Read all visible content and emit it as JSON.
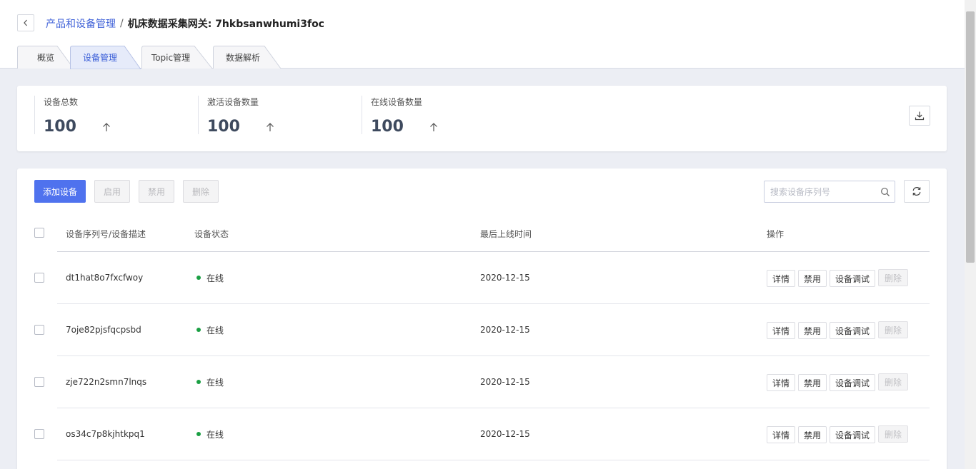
{
  "breadcrumb": {
    "parent": "产品和设备管理",
    "separator": "/",
    "current": "机床数据采集网关: 7hkbsanwhumi3foc"
  },
  "tabs": [
    {
      "label": "概览",
      "active": false
    },
    {
      "label": "设备管理",
      "active": true
    },
    {
      "label": "Topic管理",
      "active": false
    },
    {
      "label": "数据解析",
      "active": false
    }
  ],
  "stats": [
    {
      "label": "设备总数",
      "value": "100"
    },
    {
      "label": "激活设备数量",
      "value": "100"
    },
    {
      "label": "在线设备数量",
      "value": "100"
    }
  ],
  "toolbar": {
    "add_label": "添加设备",
    "enable_label": "启用",
    "disable_label": "禁用",
    "delete_label": "删除"
  },
  "search": {
    "placeholder": "搜索设备序列号"
  },
  "table": {
    "columns": [
      "设备序列号/设备描述",
      "设备状态",
      "最后上线时间",
      "操作"
    ],
    "rows": [
      {
        "serial": "dt1hat8o7fxcfwoy",
        "status": "在线",
        "last_online": "2020-12-15"
      },
      {
        "serial": "7oje82pjsfqcpsbd",
        "status": "在线",
        "last_online": "2020-12-15"
      },
      {
        "serial": "zje722n2smn7lnqs",
        "status": "在线",
        "last_online": "2020-12-15"
      },
      {
        "serial": "os34c7p8kjhtkpq1",
        "status": "在线",
        "last_online": "2020-12-15"
      }
    ],
    "actions": {
      "detail": "详情",
      "disable": "禁用",
      "debug": "设备调试",
      "delete": "删除"
    }
  },
  "colors": {
    "primary": "#4f72ee",
    "link": "#4062d8",
    "online": "#1a9f43",
    "page_bg": "#eceef4"
  },
  "icons": [
    "chevron-left-icon",
    "arrow-up-icon",
    "download-icon",
    "search-icon",
    "refresh-icon"
  ]
}
